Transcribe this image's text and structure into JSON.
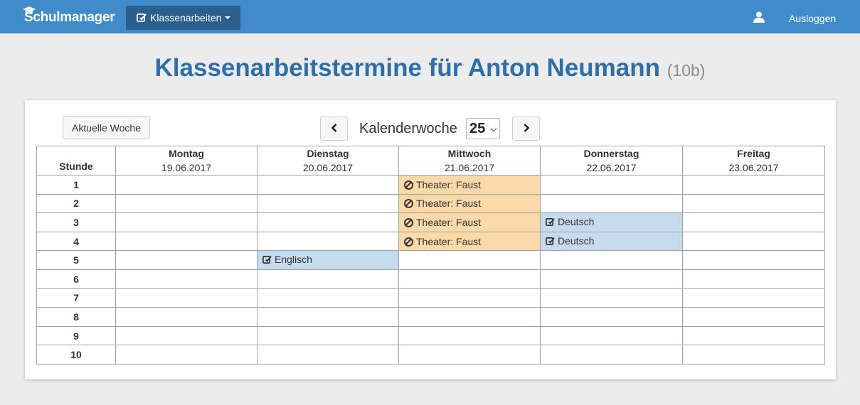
{
  "navbar": {
    "brand": "Schulmanager",
    "dropdown_label": "Klassenarbeiten",
    "logout_label": "Ausloggen"
  },
  "page": {
    "title": "Klassenarbeitstermine für Anton Neumann",
    "class": "(10b)"
  },
  "controls": {
    "current_week_label": "Aktuelle Woche",
    "week_label": "Kalenderwoche",
    "week_value": "25"
  },
  "table": {
    "stunde_label": "Stunde",
    "days": [
      {
        "name": "Montag",
        "date": "19.06.2017"
      },
      {
        "name": "Dienstag",
        "date": "20.06.2017"
      },
      {
        "name": "Mittwoch",
        "date": "21.06.2017"
      },
      {
        "name": "Donnerstag",
        "date": "22.06.2017"
      },
      {
        "name": "Freitag",
        "date": "23.06.2017"
      }
    ],
    "rows": [
      {
        "hour": "1",
        "cells": [
          "",
          "",
          {
            "type": "other",
            "text": "Theater: Faust"
          },
          "",
          ""
        ]
      },
      {
        "hour": "2",
        "cells": [
          "",
          "",
          {
            "type": "other",
            "text": "Theater: Faust"
          },
          "",
          ""
        ]
      },
      {
        "hour": "3",
        "cells": [
          "",
          "",
          {
            "type": "other",
            "text": "Theater: Faust"
          },
          {
            "type": "exam",
            "text": "Deutsch"
          },
          ""
        ]
      },
      {
        "hour": "4",
        "cells": [
          "",
          "",
          {
            "type": "other",
            "text": "Theater: Faust"
          },
          {
            "type": "exam",
            "text": "Deutsch"
          },
          ""
        ]
      },
      {
        "hour": "5",
        "cells": [
          "",
          {
            "type": "exam",
            "text": "Englisch"
          },
          "",
          "",
          ""
        ]
      },
      {
        "hour": "6",
        "cells": [
          "",
          "",
          "",
          "",
          ""
        ]
      },
      {
        "hour": "7",
        "cells": [
          "",
          "",
          "",
          "",
          ""
        ]
      },
      {
        "hour": "8",
        "cells": [
          "",
          "",
          "",
          "",
          ""
        ]
      },
      {
        "hour": "9",
        "cells": [
          "",
          "",
          "",
          "",
          ""
        ]
      },
      {
        "hour": "10",
        "cells": [
          "",
          "",
          "",
          "",
          ""
        ]
      }
    ]
  },
  "colors": {
    "navbar": "#428bca",
    "title": "#2f6fa8",
    "exam_cell": "#c6dbee",
    "other_cell": "#fcd9a8"
  },
  "icons": {
    "brand": "graduation-cap-icon",
    "dropdown": "edit-square-icon",
    "user": "user-icon",
    "exam": "edit-square-icon",
    "other": "ban-icon"
  }
}
